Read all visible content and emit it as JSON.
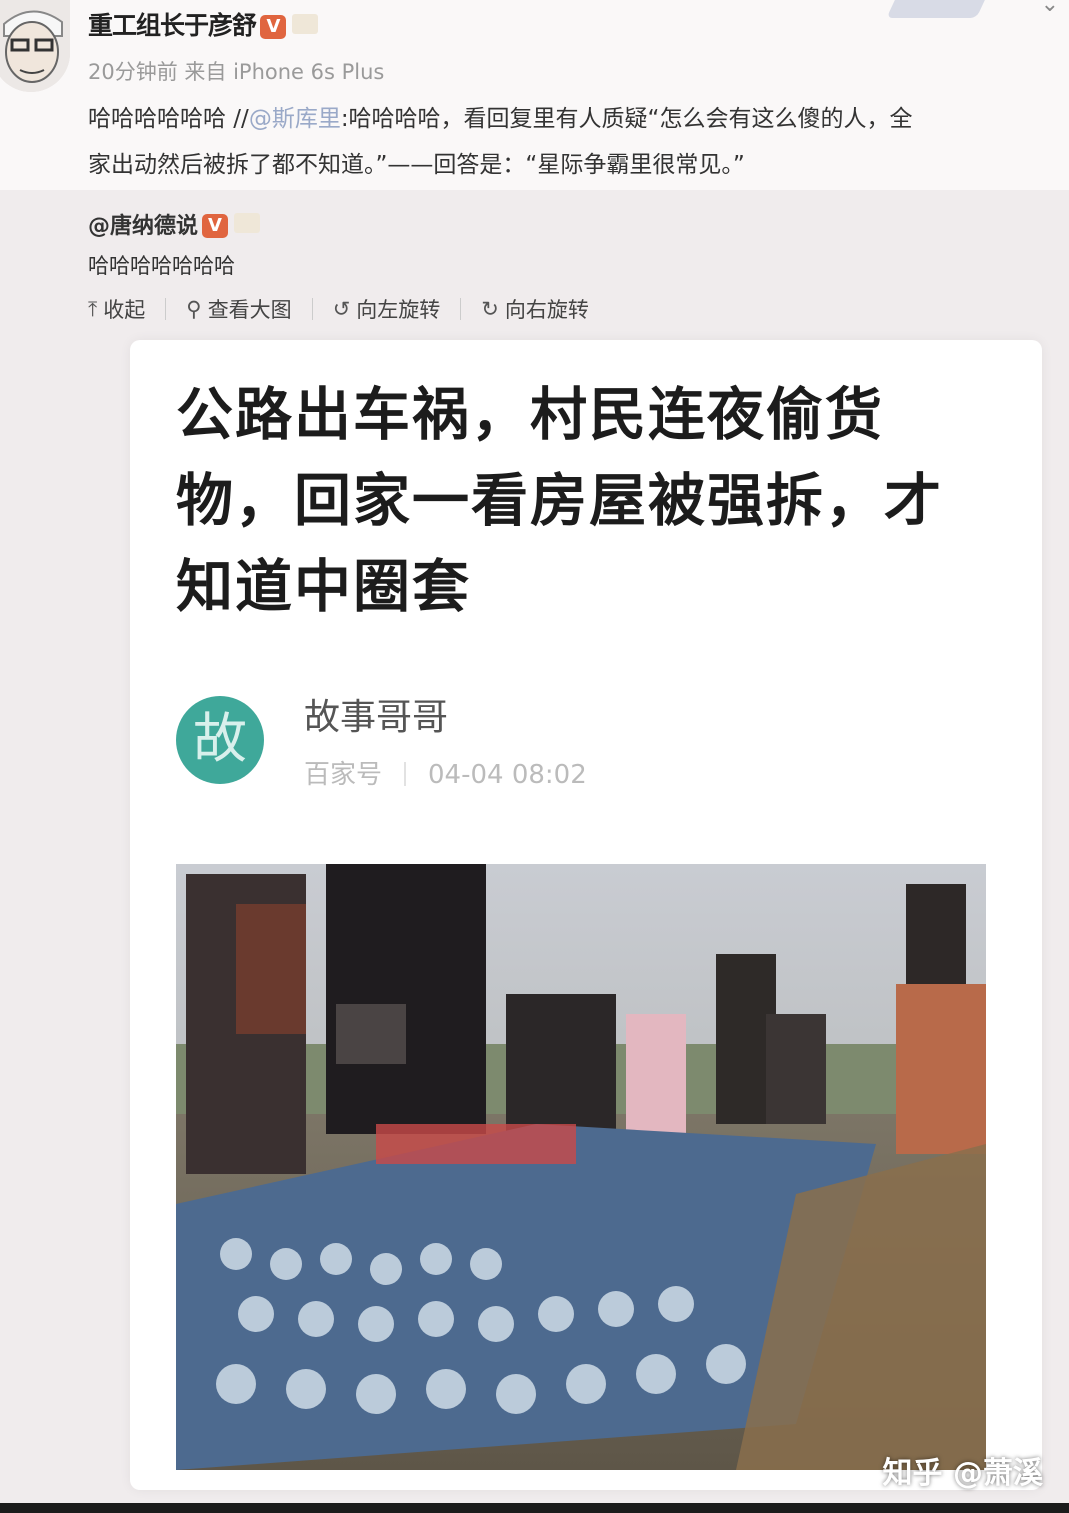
{
  "post": {
    "username": "重工组长于彦舒",
    "verified_badge": "V",
    "meta": "20分钟前 来自 iPhone 6s Plus",
    "text_line1_prefix": "哈哈哈哈哈哈 //",
    "text_mention": "@斯库里",
    "text_line1_rest": ":哈哈哈哈，看回复里有人质疑“怎么会有这么傻的人，全",
    "text_line2": "家出动然后被拆了都不知道。”——回答是：“星际争霸里很常见。”"
  },
  "repost": {
    "username": "@唐纳德说",
    "verified_badge": "V",
    "text": "哈哈哈哈哈哈哈",
    "actions": {
      "collapse": "收起",
      "view_large": "查看大图",
      "rotate_left": "向左旋转",
      "rotate_right": "向右旋转"
    }
  },
  "article": {
    "headline_line1": "公路出车祸，村民连夜偷货",
    "headline_line2": "物，回家一看房屋被强拆，才",
    "headline_line3": "知道中圈套",
    "source_logo": "故",
    "source_name": "故事哥哥",
    "source_platform": "百家号",
    "publish_time": "04-04 08:02"
  },
  "watermark": "知乎 @萧溪",
  "colors": {
    "accent_orange": "#e0653f",
    "mention_blue": "#9aa9c8",
    "logo_teal": "#3fa89a"
  },
  "icons": {
    "collapse": "collapse-arrow-icon",
    "view_large": "magnifier-icon",
    "rotate_left": "rotate-left-icon",
    "rotate_right": "rotate-right-icon"
  }
}
